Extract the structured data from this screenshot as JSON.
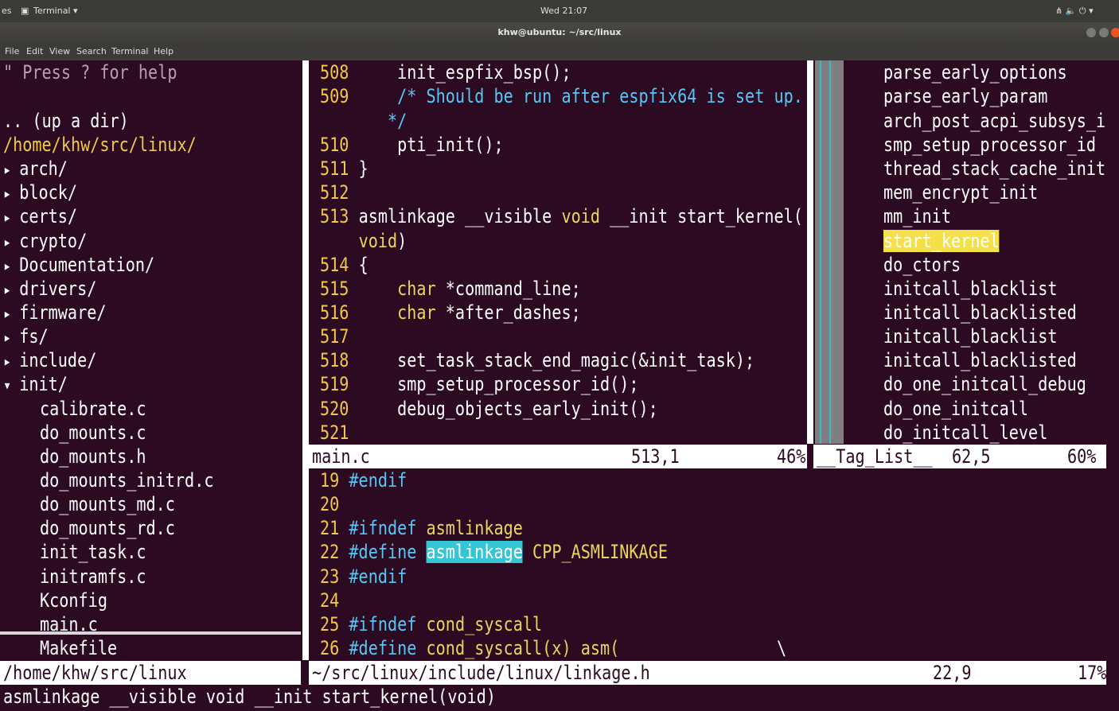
{
  "topbar": {
    "left_fragment": "es",
    "app_menu": "Terminal ▾",
    "clock": "Wed 21:07",
    "indicators": "⋔ 🔈 ⏻ ▾"
  },
  "window": {
    "title": "khw@ubuntu: ~/src/linux"
  },
  "menu": [
    "File",
    "Edit",
    "View",
    "Search",
    "Terminal",
    "Help"
  ],
  "filetree": {
    "help": "\" Press ? for help",
    "updir": ".. (up a dir)",
    "root": "/home/khw/src/linux/",
    "dirs": [
      "arch/",
      "block/",
      "certs/",
      "crypto/",
      "Documentation/",
      "drivers/",
      "firmware/",
      "fs/",
      "include/"
    ],
    "open_dir": "init/",
    "files": [
      "calibrate.c",
      "do_mounts.c",
      "do_mounts.h",
      "do_mounts_initrd.c",
      "do_mounts_md.c",
      "do_mounts_rd.c",
      "init_task.c",
      "initramfs.c",
      "Kconfig",
      "main.c"
    ],
    "selected_file": "Makefile",
    "status": "/home/khw/src/linux"
  },
  "editor_top": {
    "lines": [
      {
        "num": "508",
        "code": "    init_espfix_bsp();"
      },
      {
        "num": "509",
        "comment": "    /* Should be run after espfix64 is set up."
      },
      {
        "num": "",
        "comment": "   */"
      },
      {
        "num": "510",
        "code": "    pti_init();"
      },
      {
        "num": "511",
        "code": "}"
      },
      {
        "num": "512",
        "code": ""
      },
      {
        "num": "513",
        "code": "asmlinkage __visible ",
        "type": "void",
        "code2": " __init start_kernel("
      },
      {
        "num": "",
        "type": "void",
        "code2": ")"
      },
      {
        "num": "514",
        "code": "{"
      },
      {
        "num": "515",
        "code": "    ",
        "type": "char",
        "code2": " *command_line;"
      },
      {
        "num": "516",
        "code": "    ",
        "type": "char",
        "code2": " *after_dashes;"
      },
      {
        "num": "517",
        "code": ""
      },
      {
        "num": "518",
        "code": "    set_task_stack_end_magic(&init_task);"
      },
      {
        "num": "519",
        "code": "    smp_setup_processor_id();"
      },
      {
        "num": "520",
        "code": "    debug_objects_early_init();"
      },
      {
        "num": "521",
        "code": ""
      }
    ],
    "status_file": "main.c",
    "status_pos": "513,1",
    "status_pct": "46%"
  },
  "taglist": {
    "tags": [
      "parse_early_options",
      "parse_early_param",
      "arch_post_acpi_subsys_i",
      "smp_setup_processor_id",
      "thread_stack_cache_init",
      "mem_encrypt_init",
      "mm_init",
      "start_kernel",
      "do_ctors",
      "initcall_blacklist",
      "initcall_blacklisted",
      "initcall_blacklist",
      "initcall_blacklisted",
      "do_one_initcall_debug",
      "do_one_initcall",
      "do_initcall_level"
    ],
    "current": "start_kernel",
    "status_name": "__Tag_List__",
    "status_pos": "62,5",
    "status_pct": "60%"
  },
  "editor_bottom": {
    "lines": [
      {
        "num": "19",
        "pre": "#endif"
      },
      {
        "num": "20",
        "pre": ""
      },
      {
        "num": "21",
        "pre": "#ifndef",
        "code": " asmlinkage"
      },
      {
        "num": "22",
        "pre": "#define",
        "hl": "asmlinkage",
        "code": " CPP_ASMLINKAGE"
      },
      {
        "num": "23",
        "pre": "#endif"
      },
      {
        "num": "24",
        "pre": ""
      },
      {
        "num": "25",
        "pre": "#ifndef",
        "code": " cond_syscall"
      },
      {
        "num": "26",
        "pre": "#define",
        "code": " cond_syscall(x) asm(",
        "tail": "\\"
      }
    ],
    "status_file": "~/src/linux/include/linux/linkage.h",
    "status_pos": "22,9",
    "status_pct": "17%"
  },
  "cmdline": "asmlinkage __visible void __init start_kernel(void)"
}
